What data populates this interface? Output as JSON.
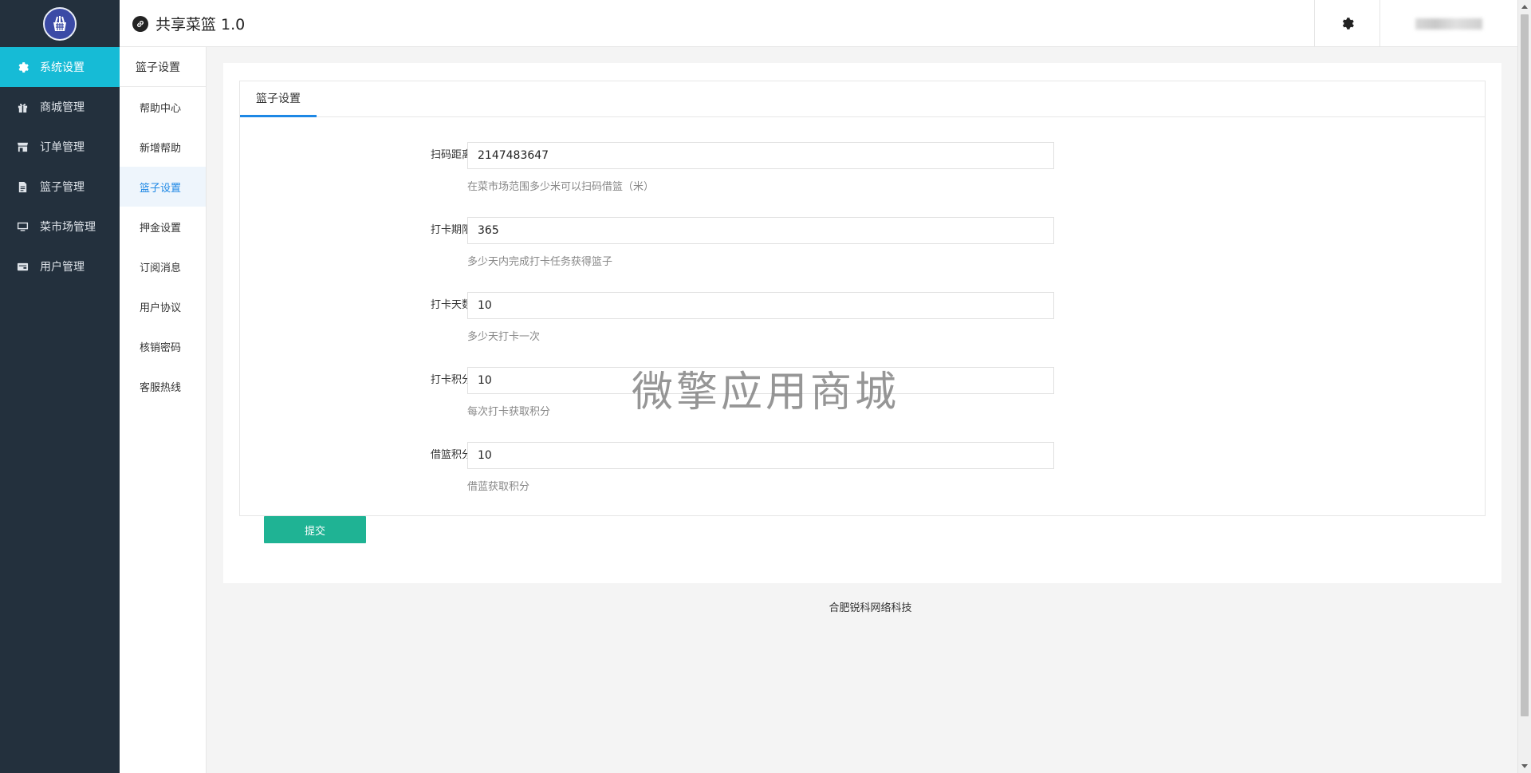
{
  "header": {
    "app_title": "共享菜篮 1.0"
  },
  "sidebar": {
    "items": [
      {
        "label": "系统设置",
        "icon": "gear-icon",
        "active": true
      },
      {
        "label": "商城管理",
        "icon": "gift-icon",
        "active": false
      },
      {
        "label": "订单管理",
        "icon": "store-icon",
        "active": false
      },
      {
        "label": "篮子管理",
        "icon": "document-icon",
        "active": false
      },
      {
        "label": "菜市场管理",
        "icon": "monitor-icon",
        "active": false
      },
      {
        "label": "用户管理",
        "icon": "wallet-icon",
        "active": false
      }
    ]
  },
  "subnav": {
    "title": "篮子设置",
    "items": [
      {
        "label": "帮助中心",
        "active": false
      },
      {
        "label": "新增帮助",
        "active": false
      },
      {
        "label": "篮子设置",
        "active": true
      },
      {
        "label": "押金设置",
        "active": false
      },
      {
        "label": "订阅消息",
        "active": false
      },
      {
        "label": "用户协议",
        "active": false
      },
      {
        "label": "核销密码",
        "active": false
      },
      {
        "label": "客服热线",
        "active": false
      }
    ]
  },
  "main": {
    "tab_label": "篮子设置",
    "fields": [
      {
        "label": "扫码距离",
        "value": "2147483647",
        "hint": "在菜市场范围多少米可以扫码借篮（米）"
      },
      {
        "label": "打卡期限",
        "value": "365",
        "hint": "多少天内完成打卡任务获得篮子"
      },
      {
        "label": "打卡天数",
        "value": "10",
        "hint": "多少天打卡一次"
      },
      {
        "label": "打卡积分",
        "value": "10",
        "hint": "每次打卡获取积分"
      },
      {
        "label": "借篮积分",
        "value": "10",
        "hint": "借蓝获取积分"
      }
    ],
    "submit_label": "提交"
  },
  "watermark": "微擎应用商城",
  "footer": {
    "text": "合肥锐科网络科技"
  },
  "colors": {
    "sidebar_bg": "#23303d",
    "active_accent": "#16bbd6",
    "tab_underline": "#1e88e5",
    "submit_bg": "#1fb394"
  }
}
